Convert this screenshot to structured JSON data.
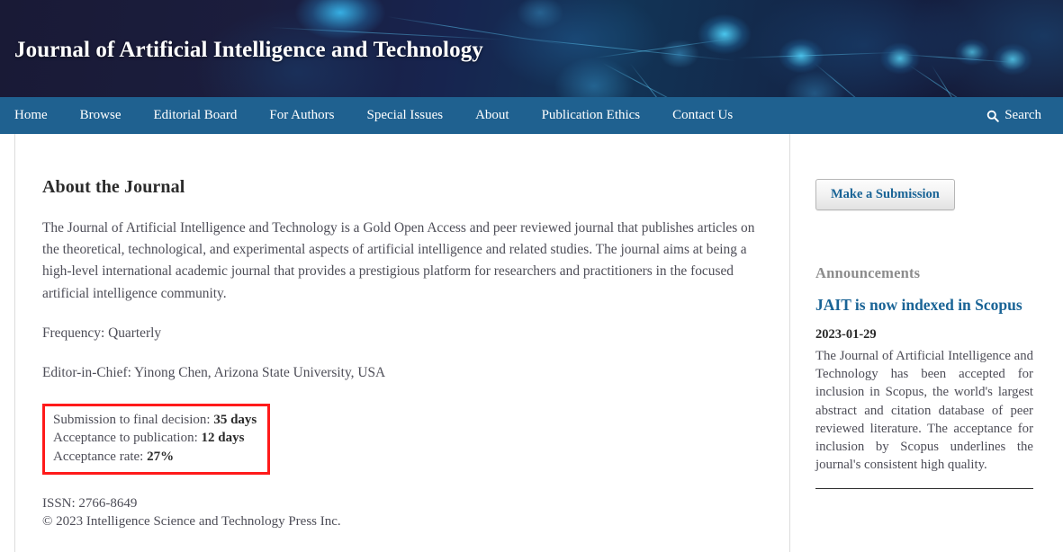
{
  "header": {
    "title": "Journal of Artificial Intelligence and Technology",
    "background_color": "#171a39",
    "accent_color": "#4ec8ff"
  },
  "nav": {
    "background_color": "#1f6190",
    "items": [
      {
        "label": "Home"
      },
      {
        "label": "Browse"
      },
      {
        "label": "Editorial Board"
      },
      {
        "label": "For Authors"
      },
      {
        "label": "Special Issues"
      },
      {
        "label": "About"
      },
      {
        "label": "Publication Ethics"
      },
      {
        "label": "Contact Us"
      }
    ],
    "search_label": "Search",
    "search_icon": "search-icon"
  },
  "main": {
    "page_title": "About the Journal",
    "intro_paragraph": "The Journal of Artificial Intelligence and Technology is a Gold Open Access and peer reviewed journal that publishes articles on the theoretical, technological, and experimental aspects of artificial intelligence and related studies. The journal aims at being a high-level international academic journal that provides a prestigious platform for researchers and practitioners in the focused artificial intelligence community.",
    "frequency": "Frequency: Quarterly",
    "editor_in_chief": "Editor-in-Chief: Yinong Chen, Arizona State University, USA",
    "stats_box": {
      "border_color": "#ff1a1a",
      "rows": [
        {
          "label": "Submission to final decision:",
          "value": "35 days"
        },
        {
          "label": "Acceptance to publication:",
          "value": "12 days"
        },
        {
          "label": "Acceptance rate:",
          "value": "27%"
        }
      ]
    },
    "issn": "ISSN: 2766-8649",
    "copyright": "© 2023 Intelligence Science and Technology Press Inc."
  },
  "sidebar": {
    "submission_button_label": "Make a Submission",
    "announcements_heading": "Announcements",
    "announcement": {
      "title": "JAIT is now indexed in Scopus",
      "date": "2023-01-29",
      "body": "The Journal of Artificial Intelligence and Technology has been accepted for inclusion in Scopus, the world's largest abstract and citation database of peer reviewed literature. The acceptance for inclusion by Scopus underlines the journal's consistent high quality.",
      "link_color": "#1a6496"
    }
  }
}
